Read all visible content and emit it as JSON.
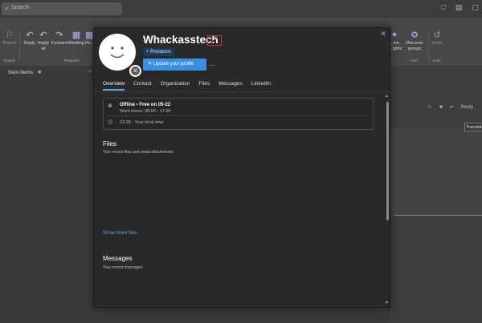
{
  "topbar": {
    "search_placeholder": "Search"
  },
  "ribbon": {
    "items": [
      {
        "label": "Report",
        "icon": "report-icon"
      },
      {
        "label": "Reply",
        "icon": "reply-icon"
      },
      {
        "label": "Reply all",
        "icon": "reply-all-icon"
      },
      {
        "label": "Forward",
        "icon": "forward-icon"
      },
      {
        "label": "Meeting",
        "icon": "meeting-icon"
      },
      {
        "label": "Re...",
        "icon": "more-icon"
      },
      {
        "label": "...ive ...ights",
        "icon": "insights-icon"
      },
      {
        "label": "Discover groups",
        "icon": "groups-icon"
      },
      {
        "label": "Undo",
        "icon": "undo-icon"
      }
    ],
    "groups": [
      "Report",
      "Respond",
      "Find",
      "Undo"
    ]
  },
  "left_pane": {
    "folder": "Sent Items"
  },
  "reading_pane": {
    "reply_label": "Reply",
    "translate_label": "Translat"
  },
  "profile": {
    "name": "Whackasstech",
    "pronouns_label": "+ Pronouns",
    "update_label": "Update your profile",
    "more_label": "...",
    "tabs": [
      "Overview",
      "Contact",
      "Organization",
      "Files",
      "Messages",
      "LinkedIn"
    ],
    "active_tab": "Overview",
    "status": {
      "title": "Offline • Free on 05-22",
      "hours": "Work hours: 08:00 - 17:00",
      "local_time": "23:28 - Your local time"
    },
    "files": {
      "heading": "Files",
      "subtitle": "Your recent files and email attachments",
      "show_more": "Show more files"
    },
    "messages": {
      "heading": "Messages",
      "subtitle": "Your recent messages"
    }
  },
  "colors": {
    "accent": "#3a8fe0",
    "link": "#5ea8ec",
    "highlight_box": "#e0312b"
  }
}
